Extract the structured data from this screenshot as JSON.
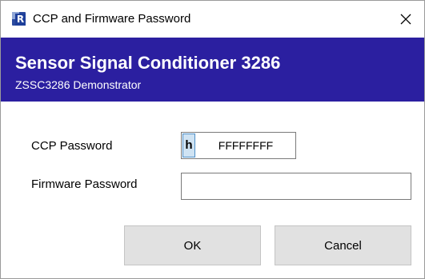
{
  "window": {
    "title": "CCP and Firmware Password",
    "icon": "app-r-icon",
    "icon_letter": "R",
    "close_icon": "close-icon"
  },
  "banner": {
    "title": "Sensor Signal Conditioner 3286",
    "subtitle": "ZSSC3286 Demonstrator",
    "color": "#2b1fa0"
  },
  "form": {
    "ccp_label": "CCP Password",
    "ccp_prefix": "h",
    "ccp_value": "FFFFFFFF",
    "firmware_label": "Firmware Password",
    "firmware_value": ""
  },
  "buttons": {
    "ok_label": "OK",
    "cancel_label": "Cancel"
  }
}
